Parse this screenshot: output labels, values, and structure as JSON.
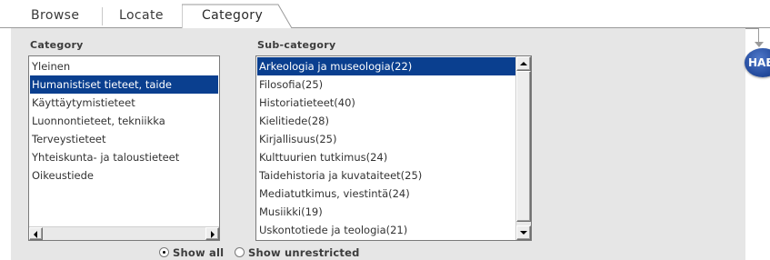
{
  "tabs": [
    {
      "label": "Browse",
      "active": false
    },
    {
      "label": "Locate",
      "active": false
    },
    {
      "label": "Category",
      "active": true
    }
  ],
  "badge": {
    "label": "HAB"
  },
  "category": {
    "label": "Category",
    "selected_index": 1,
    "items": [
      "Yleinen",
      "Humanistiset tieteet, taide",
      "Käyttäytymistieteet",
      "Luonnontieteet, tekniikka",
      "Terveystieteet",
      "Yhteiskunta- ja taloustieteet",
      "Oikeustiede"
    ]
  },
  "subcategory": {
    "label": "Sub-category",
    "selected_index": 0,
    "items": [
      "Arkeologia ja museologia(22)",
      "Filosofia(25)",
      "Historiatieteet(40)",
      "Kielitiede(28)",
      "Kirjallisuus(25)",
      "Kulttuurien tutkimus(24)",
      "Taidehistoria ja kuvataiteet(25)",
      "Mediatutkimus, viestintä(24)",
      "Musiikki(19)",
      "Uskontotiede ja teologia(21)"
    ]
  },
  "filter": {
    "options": [
      {
        "label": "Show all",
        "checked": true
      },
      {
        "label": "Show unrestricted",
        "checked": false
      }
    ]
  },
  "colors": {
    "selection": "#0a3f8f",
    "panel": "#e6e6e6",
    "badge": "#234a9c"
  }
}
